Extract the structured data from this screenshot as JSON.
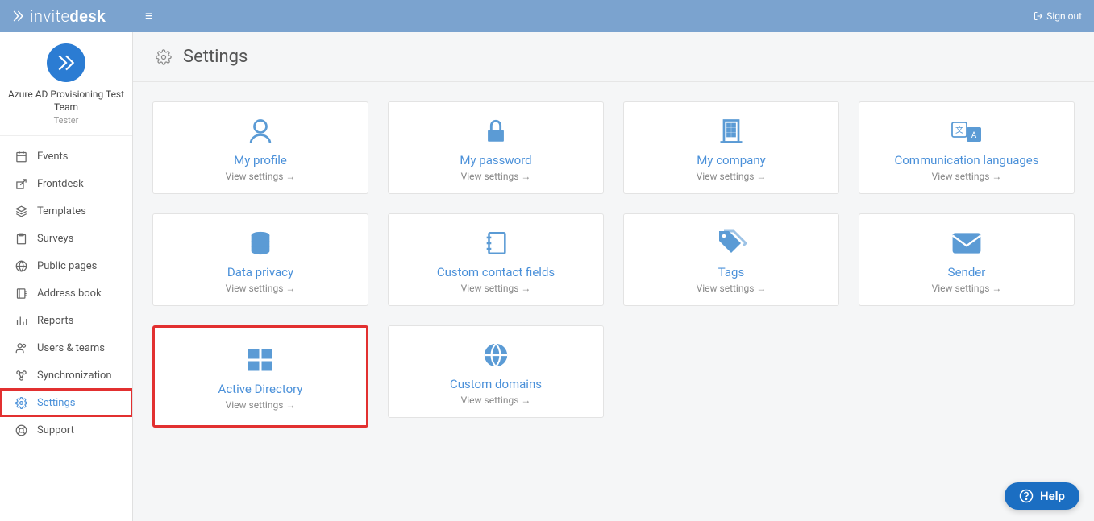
{
  "brand": {
    "part1": "invite",
    "part2": "desk"
  },
  "topbar": {
    "signout": "Sign out"
  },
  "org": {
    "name": "Azure AD Provisioning Test Team",
    "role": "Tester"
  },
  "nav": {
    "events": "Events",
    "frontdesk": "Frontdesk",
    "templates": "Templates",
    "surveys": "Surveys",
    "publicpages": "Public pages",
    "addressbook": "Address book",
    "reports": "Reports",
    "usersteams": "Users & teams",
    "sync": "Synchronization",
    "settings": "Settings",
    "support": "Support"
  },
  "page": {
    "title": "Settings"
  },
  "cards": {
    "view": "View settings →",
    "profile": "My profile",
    "password": "My password",
    "company": "My company",
    "languages": "Communication languages",
    "privacy": "Data privacy",
    "contactfields": "Custom contact fields",
    "tags": "Tags",
    "sender": "Sender",
    "ad": "Active Directory",
    "domains": "Custom domains"
  },
  "help": {
    "label": "Help"
  }
}
